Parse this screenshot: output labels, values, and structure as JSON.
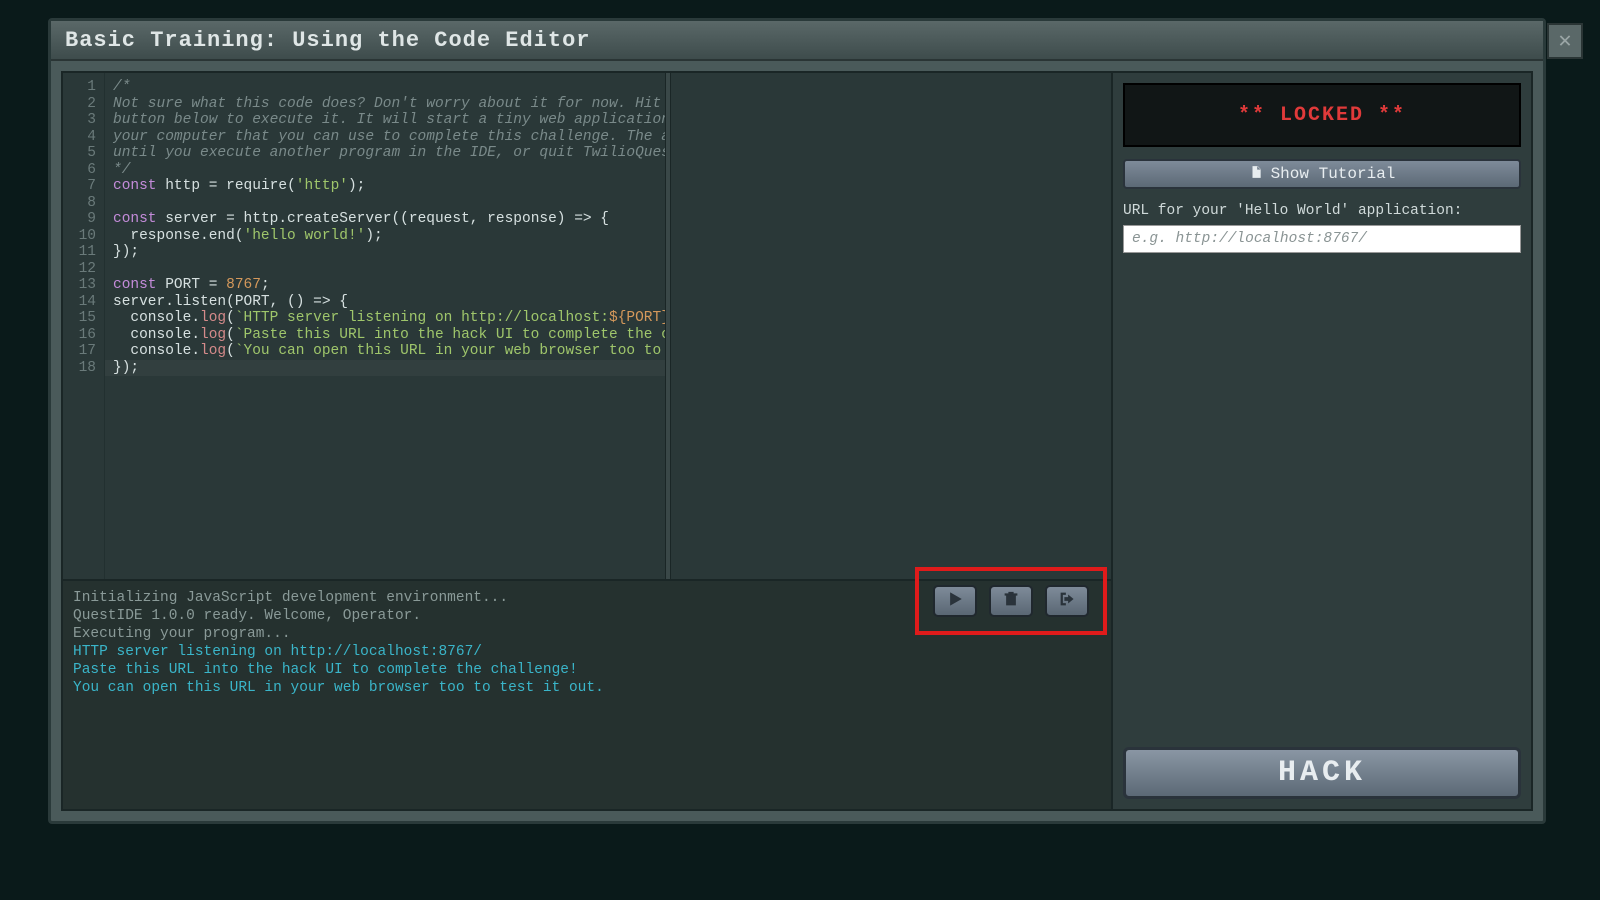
{
  "window": {
    "title": "Basic Training: Using the Code Editor",
    "close_glyph": "✕"
  },
  "editor": {
    "lines": [
      {
        "n": 1,
        "segs": [
          {
            "c": "tk-comment",
            "t": "/*"
          }
        ]
      },
      {
        "n": 2,
        "segs": [
          {
            "c": "tk-comment",
            "t": "Not sure what this code does? Don't worry about it for now. Hit the \"play\""
          }
        ]
      },
      {
        "n": 3,
        "segs": [
          {
            "c": "tk-comment",
            "t": "button below to execute it. It will start a tiny web application running on"
          }
        ]
      },
      {
        "n": 4,
        "segs": [
          {
            "c": "tk-comment",
            "t": "your computer that you can use to complete this challenge. The app will run"
          }
        ]
      },
      {
        "n": 5,
        "segs": [
          {
            "c": "tk-comment",
            "t": "until you execute another program in the IDE, or quit TwilioQuest."
          }
        ]
      },
      {
        "n": 6,
        "segs": [
          {
            "c": "tk-comment",
            "t": "*/"
          }
        ]
      },
      {
        "n": 7,
        "segs": [
          {
            "c": "tk-keyword",
            "t": "const"
          },
          {
            "c": "tk-punc",
            "t": " "
          },
          {
            "c": "tk-ident",
            "t": "http"
          },
          {
            "c": "tk-punc",
            "t": " = "
          },
          {
            "c": "tk-ident",
            "t": "require"
          },
          {
            "c": "tk-punc",
            "t": "("
          },
          {
            "c": "tk-string",
            "t": "'http'"
          },
          {
            "c": "tk-punc",
            "t": ");"
          }
        ]
      },
      {
        "n": 8,
        "segs": []
      },
      {
        "n": 9,
        "segs": [
          {
            "c": "tk-keyword",
            "t": "const"
          },
          {
            "c": "tk-punc",
            "t": " "
          },
          {
            "c": "tk-ident",
            "t": "server"
          },
          {
            "c": "tk-punc",
            "t": " = http.createServer((request, response) => {"
          }
        ]
      },
      {
        "n": 10,
        "segs": [
          {
            "c": "tk-punc",
            "t": "  response.end("
          },
          {
            "c": "tk-string",
            "t": "'hello world!'"
          },
          {
            "c": "tk-punc",
            "t": ");"
          }
        ]
      },
      {
        "n": 11,
        "segs": [
          {
            "c": "tk-punc",
            "t": "});"
          }
        ]
      },
      {
        "n": 12,
        "segs": []
      },
      {
        "n": 13,
        "segs": [
          {
            "c": "tk-keyword",
            "t": "const"
          },
          {
            "c": "tk-punc",
            "t": " "
          },
          {
            "c": "tk-ident",
            "t": "PORT"
          },
          {
            "c": "tk-punc",
            "t": " = "
          },
          {
            "c": "tk-number",
            "t": "8767"
          },
          {
            "c": "tk-punc",
            "t": ";"
          }
        ]
      },
      {
        "n": 14,
        "segs": [
          {
            "c": "tk-ident",
            "t": "server"
          },
          {
            "c": "tk-punc",
            "t": ".listen(PORT, () => {"
          }
        ]
      },
      {
        "n": 15,
        "segs": [
          {
            "c": "tk-punc",
            "t": "  console."
          },
          {
            "c": "tk-method",
            "t": "log"
          },
          {
            "c": "tk-punc",
            "t": "("
          },
          {
            "c": "tk-string",
            "t": "`HTTP server listening on http://localhost:"
          },
          {
            "c": "tk-tmpl",
            "t": "${PORT}"
          },
          {
            "c": "tk-string",
            "t": "/`"
          },
          {
            "c": "tk-punc",
            "t": ");"
          }
        ]
      },
      {
        "n": 16,
        "segs": [
          {
            "c": "tk-punc",
            "t": "  console."
          },
          {
            "c": "tk-method",
            "t": "log"
          },
          {
            "c": "tk-punc",
            "t": "("
          },
          {
            "c": "tk-string",
            "t": "`Paste this URL into the hack UI to complete the challenge!`"
          },
          {
            "c": "tk-punc",
            "t": ");"
          }
        ]
      },
      {
        "n": 17,
        "segs": [
          {
            "c": "tk-punc",
            "t": "  console."
          },
          {
            "c": "tk-method",
            "t": "log"
          },
          {
            "c": "tk-punc",
            "t": "("
          },
          {
            "c": "tk-string",
            "t": "`You can open this URL in your web browser too to test it out.`"
          },
          {
            "c": "tk-punc",
            "t": ");"
          }
        ]
      },
      {
        "n": 18,
        "segs": [
          {
            "c": "tk-punc",
            "t": "});"
          }
        ]
      }
    ],
    "current_line": 18
  },
  "console": {
    "lines": [
      {
        "cls": "sys",
        "t": "Initializing JavaScript development environment..."
      },
      {
        "cls": "sys",
        "t": "QuestIDE 1.0.0 ready. Welcome, Operator."
      },
      {
        "cls": "sys",
        "t": "Executing your program..."
      },
      {
        "cls": "out",
        "t": "HTTP server listening on http://localhost:8767/"
      },
      {
        "cls": "out",
        "t": "Paste this URL into the hack UI to complete the challenge!"
      },
      {
        "cls": "out",
        "t": "You can open this URL in your web browser too to test it out."
      }
    ]
  },
  "toolbar": {
    "play": "play",
    "trash": "trash",
    "exit": "exit"
  },
  "side": {
    "locked_label": "**  LOCKED  **",
    "tutorial_label": "Show Tutorial",
    "url_label": "URL for your 'Hello World' application:",
    "url_placeholder": "e.g. http://localhost:8767/",
    "hack_label": "HACK"
  }
}
